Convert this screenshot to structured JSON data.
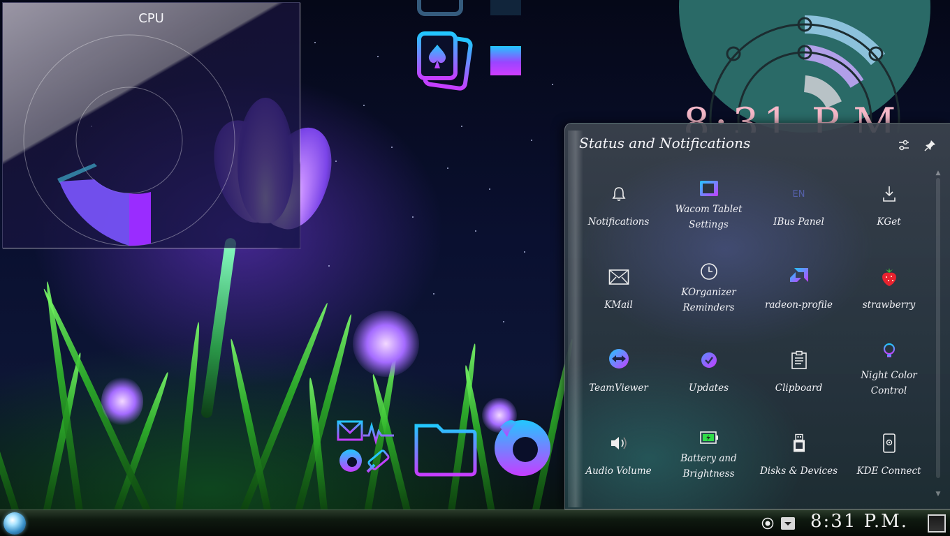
{
  "cpu_widget": {
    "title": "CPU"
  },
  "clock_widget": {
    "time": "8:31 P.M."
  },
  "notifications_panel": {
    "title": "Status and Notifications",
    "items": [
      {
        "label": "Notifications",
        "icon": "bell-icon"
      },
      {
        "label": "Wacom Tablet Settings",
        "icon": "tablet-icon"
      },
      {
        "label": "IBus Panel",
        "icon": "keyboard-layout-icon",
        "badge": "EN"
      },
      {
        "label": "KGet",
        "icon": "download-icon"
      },
      {
        "label": "KMail",
        "icon": "mail-icon"
      },
      {
        "label": "KOrganizer Reminders",
        "icon": "clock-icon"
      },
      {
        "label": "radeon-profile",
        "icon": "amd-logo-icon"
      },
      {
        "label": "strawberry",
        "icon": "strawberry-icon"
      },
      {
        "label": "TeamViewer",
        "icon": "teamviewer-icon"
      },
      {
        "label": "Updates",
        "icon": "updates-check-icon"
      },
      {
        "label": "Clipboard",
        "icon": "clipboard-icon"
      },
      {
        "label": "Night Color Control",
        "icon": "lightbulb-icon"
      },
      {
        "label": "Audio Volume",
        "icon": "speaker-icon"
      },
      {
        "label": "Battery and Brightness",
        "icon": "battery-icon"
      },
      {
        "label": "Disks & Devices",
        "icon": "usb-drive-icon"
      },
      {
        "label": "KDE Connect",
        "icon": "phone-icon"
      }
    ]
  },
  "taskbar": {
    "time": "8:31 P.M."
  },
  "colors": {
    "accent_gradient_start": "#22c7ff",
    "accent_gradient_end": "#c63dff",
    "clock_text": "#f5b8c8",
    "clock_bg": "#2a6a67"
  }
}
